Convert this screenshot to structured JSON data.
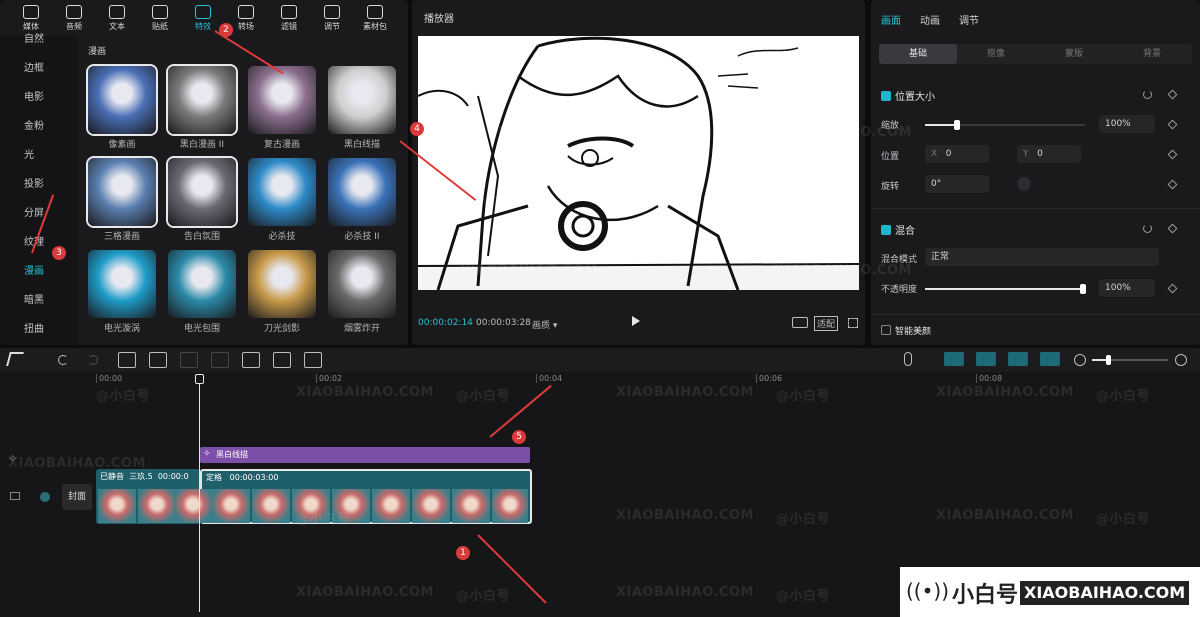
{
  "toolbar": {
    "items": [
      {
        "label": "媒体",
        "icon": "media-icon"
      },
      {
        "label": "音频",
        "icon": "audio-icon"
      },
      {
        "label": "文本",
        "icon": "text-icon"
      },
      {
        "label": "贴纸",
        "icon": "sticker-icon"
      },
      {
        "label": "特效",
        "icon": "effects-icon",
        "active": true
      },
      {
        "label": "转场",
        "icon": "transition-icon"
      },
      {
        "label": "滤镜",
        "icon": "filter-icon"
      },
      {
        "label": "调节",
        "icon": "adjust-icon"
      },
      {
        "label": "素材包",
        "icon": "material-pack-icon"
      }
    ]
  },
  "categories": [
    "自然",
    "边框",
    "电影",
    "金粉",
    "光",
    "投影",
    "分屏",
    "纹理",
    "漫画",
    "暗黑",
    "扭曲"
  ],
  "active_category": "漫画",
  "effects_section_title": "漫画",
  "effects": [
    "像素画",
    "黑白漫画 II",
    "复古漫画",
    "黑白线描",
    "三格漫画",
    "告白氛围",
    "必杀技",
    "必杀技 II",
    "电光漩涡",
    "电光包围",
    "刀光剑影",
    "烟雾炸开"
  ],
  "player": {
    "title": "播放器",
    "current_time": "00:00:02:14",
    "total_time": "00:00:03:28",
    "ratio_label": "画质",
    "ratio_btn": "适配"
  },
  "inspector": {
    "tabs": [
      "画面",
      "动画",
      "调节"
    ],
    "subtabs": [
      "基础",
      "抠像",
      "蒙版",
      "背景"
    ],
    "position_size": "位置大小",
    "scale_label": "缩放",
    "scale_value": "100%",
    "position_label": "位置",
    "x_label": "X",
    "x_value": "0",
    "y_label": "Y",
    "y_value": "0",
    "rotate_label": "旋转",
    "rotate_value": "0°",
    "blend": "混合",
    "blend_mode_label": "混合模式",
    "blend_mode_value": "正常",
    "opacity_label": "不透明度",
    "opacity_value": "100%",
    "beauty": "智能美颜"
  },
  "timeline": {
    "ruler": [
      "00:00",
      "00:02",
      "00:04",
      "00:06",
      "00:08"
    ],
    "effect_clip": "黑白线描",
    "video_clip_1_labels": [
      "已静音",
      "三玖.5",
      "00:00:0"
    ],
    "video_clip_2_labels": [
      "定格",
      "00:00:03:00"
    ],
    "cover_label": "封面"
  },
  "annotations": [
    "1",
    "2",
    "3",
    "4",
    "5"
  ],
  "watermark": {
    "cn": "@小白号",
    "en": "XIAOBAIHAO.COM",
    "logo_cn": "小白号",
    "logo_en": "XIAOBAIHAO.COM"
  },
  "colors": {
    "accent": "#27c3d5",
    "effect_clip": "#7c4fa8",
    "annotation": "#d93a3a"
  }
}
